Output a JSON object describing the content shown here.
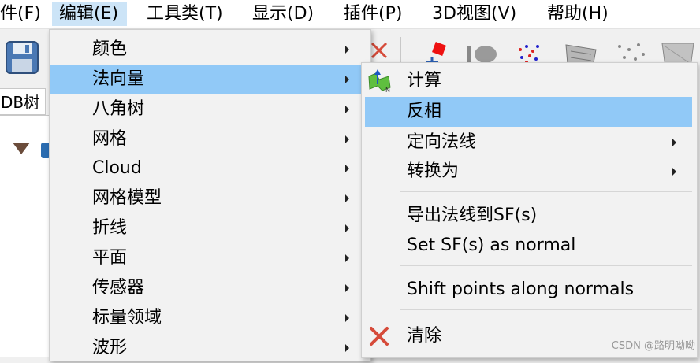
{
  "menubar": {
    "items": [
      {
        "label": "件(F)"
      },
      {
        "label": "编辑(E)"
      },
      {
        "label": "工具类(T)"
      },
      {
        "label": "显示(D)"
      },
      {
        "label": "插件(P)"
      },
      {
        "label": "3D视图(V)"
      },
      {
        "label": "帮助(H)"
      }
    ]
  },
  "left_panel": {
    "tab_label": "DB树"
  },
  "edit_menu": {
    "items": [
      {
        "label": "颜色",
        "has_submenu": true
      },
      {
        "label": "法向量",
        "has_submenu": true
      },
      {
        "label": "八角树",
        "has_submenu": true
      },
      {
        "label": "网格",
        "has_submenu": true
      },
      {
        "label": "Cloud",
        "has_submenu": true
      },
      {
        "label": "网格模型",
        "has_submenu": true
      },
      {
        "label": "折线",
        "has_submenu": true
      },
      {
        "label": "平面",
        "has_submenu": true
      },
      {
        "label": "传感器",
        "has_submenu": true
      },
      {
        "label": "标量领域",
        "has_submenu": true
      },
      {
        "label": "波形",
        "has_submenu": true
      }
    ]
  },
  "normals_menu": {
    "items": [
      {
        "label": "计算",
        "icon": "compute-normals-icon"
      },
      {
        "label": "反相"
      },
      {
        "label": "定向法线",
        "has_submenu": true
      },
      {
        "label": "转换为",
        "has_submenu": true
      },
      {
        "label": "导出法线到SF(s)"
      },
      {
        "label": "Set SF(s) as normal"
      },
      {
        "label": "Shift points along normals"
      },
      {
        "label": "清除",
        "icon": "clear-icon"
      }
    ]
  },
  "watermark": "CSDN @路明呦呦",
  "colors": {
    "menu_highlight": "#91c9f7",
    "menubar_active": "#cce4f7",
    "clear_icon_red": "#d64b3a"
  }
}
